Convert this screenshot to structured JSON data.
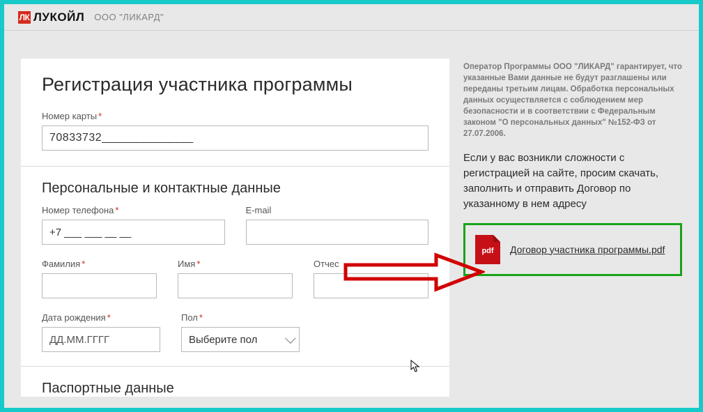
{
  "header": {
    "logo_initials": "ЛК",
    "brand": "ЛУКОЙЛ",
    "company": "ООО \"ЛИКАРД\""
  },
  "form": {
    "title": "Регистрация участника программы",
    "card": {
      "label": "Номер карты",
      "value": "70833732______________"
    },
    "section_personal": "Персональные и контактные данные",
    "phone": {
      "label": "Номер телефона",
      "value": "+7 ___ ___ __ __"
    },
    "email": {
      "label": "E-mail",
      "value": ""
    },
    "surname": {
      "label": "Фамилия",
      "value": ""
    },
    "name": {
      "label": "Имя",
      "value": ""
    },
    "patronymic": {
      "label": "Отчес",
      "value": ""
    },
    "dob": {
      "label": "Дата рождения",
      "placeholder": "ДД.ММ.ГГГГ",
      "value": ""
    },
    "gender": {
      "label": "Пол",
      "selected": "Выберите пол"
    },
    "section_passport": "Паспортные данные"
  },
  "aside": {
    "disclaimer": "Оператор Программы ООО \"ЛИКАРД\" гарантирует, что указанные Вами данные не будут разглашены или переданы третьим лицам. Обработка персональных данных осуществляется с соблюдением мер безопасности и в соответствии с Федеральным законом \"О персональных данных\" №152-ФЗ от 27.07.2006.",
    "help": "Если у вас возникли сложности с регистрацией на сайте, просим скачать, заполнить и отправить Договор по указанному в нем адресу",
    "pdf_badge": "pdf",
    "download_text": "Договор участника программы.pdf"
  }
}
